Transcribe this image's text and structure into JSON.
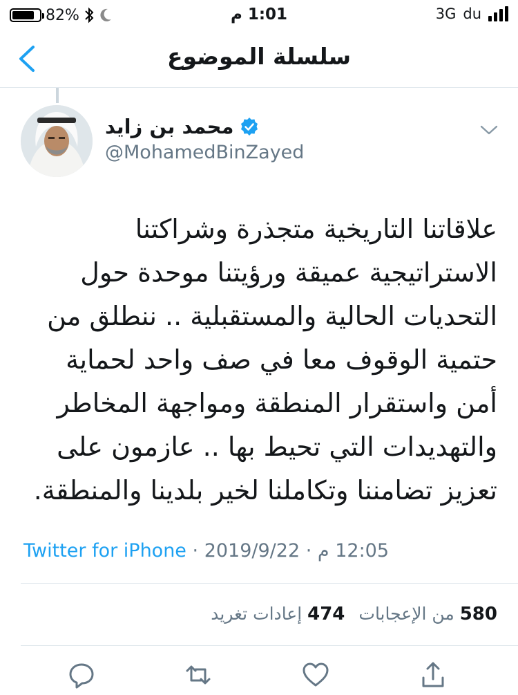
{
  "status_bar": {
    "battery_percent": "82%",
    "battery_level": 0.82,
    "time": "1:01 م",
    "network": "3G",
    "carrier": "du"
  },
  "nav": {
    "title": "سلسلة الموضوع"
  },
  "tweet": {
    "display_name": "محمد بن زايد",
    "handle": "@MohamedBinZayed",
    "verified": true,
    "text": "علاقاتنا التاريخية متجذرة وشراكتنا الاستراتيجية عميقة ورؤيتنا موحدة حول التحديات الحالية والمستقبلية .. ننطلق من حتمية الوقوف معا في صف واحد لحماية أمن واستقرار المنطقة ومواجهة المخاطر والتهديدات التي تحيط بها .. عازمون على تعزيز تضامننا وتكاملنا لخير بلدينا والمنطقة.",
    "time": "12:05 م",
    "date": "2019/9/22",
    "source": "Twitter for iPhone"
  },
  "stats": {
    "likes_count": "580",
    "likes_label": "من الإعجابات",
    "retweets_count": "474",
    "retweets_label": "إعادات تغريد"
  },
  "icons": {
    "back": "chevron-left-icon",
    "verified": "verified-badge-icon",
    "more": "chevron-down-icon",
    "reply": "reply-icon",
    "retweet": "retweet-icon",
    "like": "heart-icon",
    "share": "share-icon"
  },
  "colors": {
    "accent": "#1da1f2",
    "secondary_text": "#657786",
    "divider": "#e1e8ed"
  }
}
